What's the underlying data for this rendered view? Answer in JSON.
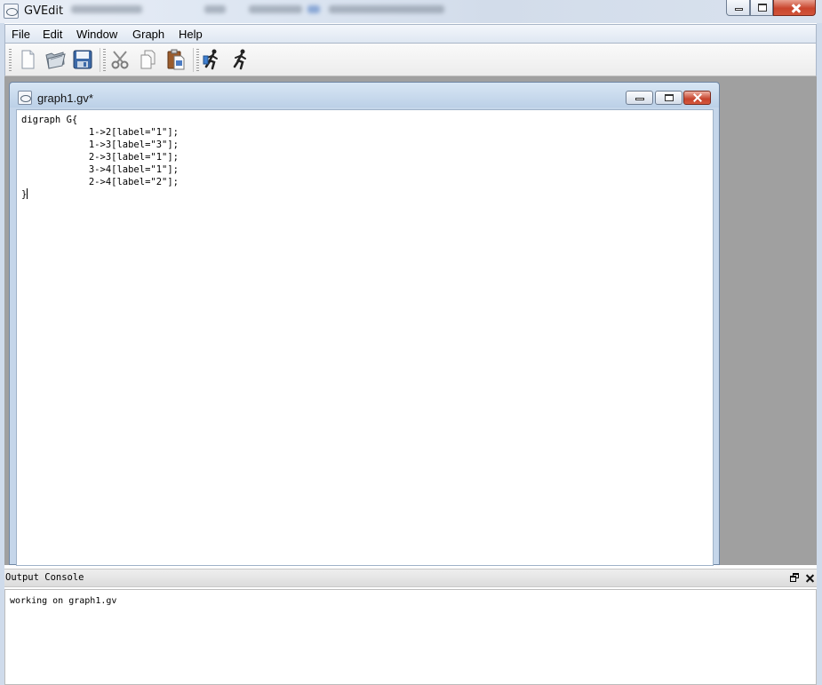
{
  "window": {
    "title": "GVEdit",
    "accent_color": "#c5d6ea",
    "controls": [
      "minimize-icon",
      "maximize-icon",
      "close-icon"
    ]
  },
  "menubar": {
    "items": [
      "File",
      "Edit",
      "Window",
      "Graph",
      "Help"
    ]
  },
  "toolbar": {
    "buttons": [
      {
        "name": "new-file-button",
        "icon": "new-document-icon"
      },
      {
        "name": "open-file-button",
        "icon": "open-folder-icon"
      },
      {
        "name": "save-file-button",
        "icon": "floppy-disk-icon"
      },
      {
        "name": "cut-button",
        "icon": "scissors-icon"
      },
      {
        "name": "copy-button",
        "icon": "copy-icon"
      },
      {
        "name": "paste-button",
        "icon": "paste-clipboard-icon"
      },
      {
        "name": "layout-settings-button",
        "icon": "runner-settings-icon"
      },
      {
        "name": "run-layout-button",
        "icon": "runner-icon"
      }
    ]
  },
  "document": {
    "title": "graph1.gv*",
    "lines": [
      "digraph G{",
      "            1->2[label=\"1\"];",
      "            1->3[label=\"3\"];",
      "            2->3[label=\"1\"];",
      "            3->4[label=\"1\"];",
      "            2->4[label=\"2\"];",
      "}"
    ]
  },
  "console": {
    "title": "Output Console",
    "message": "working on graph1.gv"
  }
}
